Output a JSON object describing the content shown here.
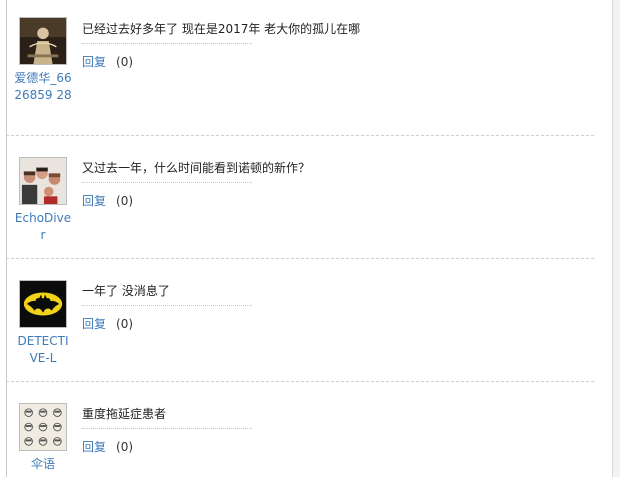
{
  "comments": [
    {
      "user": "爱德华_6626859 28",
      "text": "已经过去好多年了 现在是2017年 老大你的孤儿在哪",
      "reply_label": "回复",
      "count": "(0)",
      "avatar_icon": "movie-poster-avatar-icon"
    },
    {
      "user": "EchoDiver",
      "text": "又过去一年，什么时间能看到诺顿的新作？",
      "reply_label": "回复",
      "count": "(0)",
      "avatar_icon": "band-photo-avatar-icon"
    },
    {
      "user": "DETECTIVE-L",
      "text": "一年了 没消息了",
      "reply_label": "回复",
      "count": "(0)",
      "avatar_icon": "batman-logo-avatar-icon"
    },
    {
      "user": "伞语",
      "text": "重度拖延症患者",
      "reply_label": "回复",
      "count": "(0)",
      "avatar_icon": "sketch-faces-avatar-icon"
    }
  ],
  "colors": {
    "link": "#3e7ab8",
    "text": "#222222",
    "divider": "#cfcfcf"
  }
}
